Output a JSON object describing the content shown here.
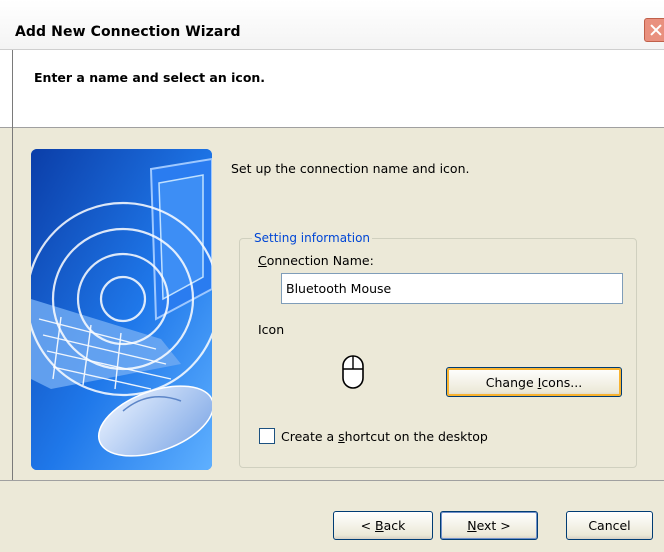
{
  "window": {
    "title": "Add New Connection Wizard"
  },
  "header": {
    "heading": "Enter a name and select an icon."
  },
  "main": {
    "intro": "Set up the connection name and icon.",
    "group": {
      "legend": "Setting information",
      "connection_name_label": "Connection Name:",
      "connection_name_value": "Bluetooth Mouse",
      "icon_label": "Icon",
      "selected_icon": "mouse-icon",
      "change_icons_button": "Change Icons...",
      "shortcut_checkbox_label": "Create a shortcut on the desktop",
      "shortcut_checked": false
    }
  },
  "footer": {
    "back_button": "< Back",
    "next_button": "Next >",
    "cancel_button": "Cancel"
  },
  "colors": {
    "dialog_bg": "#ece9d8",
    "group_legend": "#0046d5",
    "button_border": "#003c74",
    "focus_ring": "#f8b330"
  }
}
